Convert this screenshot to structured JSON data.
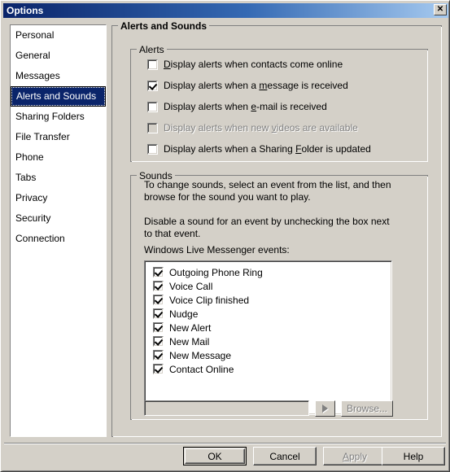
{
  "window": {
    "title": "Options",
    "close_icon": "close-icon",
    "close_label": "✕"
  },
  "sidebar": {
    "items": [
      {
        "label": "Personal",
        "selected": false
      },
      {
        "label": "General",
        "selected": false
      },
      {
        "label": "Messages",
        "selected": false
      },
      {
        "label": "Alerts and Sounds",
        "selected": true
      },
      {
        "label": "Sharing Folders",
        "selected": false
      },
      {
        "label": "File Transfer",
        "selected": false
      },
      {
        "label": "Phone",
        "selected": false
      },
      {
        "label": "Tabs",
        "selected": false
      },
      {
        "label": "Privacy",
        "selected": false
      },
      {
        "label": "Security",
        "selected": false
      },
      {
        "label": "Connection",
        "selected": false
      }
    ]
  },
  "main": {
    "page_title": "Alerts and Sounds",
    "alerts": {
      "group_label": "Alerts",
      "checkboxes": [
        {
          "pre": "",
          "accel": "D",
          "post": "isplay alerts when contacts come online",
          "checked": false,
          "disabled": false
        },
        {
          "pre": "Display alerts when a ",
          "accel": "m",
          "post": "essage is received",
          "checked": true,
          "disabled": false
        },
        {
          "pre": "Display alerts when ",
          "accel": "e",
          "post": "-mail is received",
          "checked": false,
          "disabled": false
        },
        {
          "pre": "Display alerts when new ",
          "accel": "v",
          "post": "ideos are available",
          "checked": false,
          "disabled": true
        },
        {
          "pre": "Display alerts when a Sharing ",
          "accel": "F",
          "post": "older is updated",
          "checked": false,
          "disabled": false
        }
      ]
    },
    "sounds": {
      "group_label": "Sounds",
      "description_1": "To change sounds, select an event from the list, and then browse for the sound you want to play.",
      "description_2": "Disable a sound for an event by unchecking the box next to that event.",
      "events_label": "Windows Live Messenger events:",
      "events": [
        {
          "label": "Outgoing Phone Ring",
          "checked": true
        },
        {
          "label": "Voice Call",
          "checked": true
        },
        {
          "label": "Voice Clip finished",
          "checked": true
        },
        {
          "label": "Nudge",
          "checked": true
        },
        {
          "label": "New Alert",
          "checked": true
        },
        {
          "label": "New Mail",
          "checked": true
        },
        {
          "label": "New Message",
          "checked": true
        },
        {
          "label": "Contact Online",
          "checked": true
        }
      ],
      "sound_path_value": "",
      "play_icon": "play-triangle-icon",
      "browse_label": "Browse..."
    }
  },
  "footer": {
    "buttons": [
      {
        "label": "OK",
        "default": true,
        "disabled": false
      },
      {
        "label": "Cancel",
        "default": false,
        "disabled": false
      },
      {
        "label": "Apply",
        "default": false,
        "disabled": true
      },
      {
        "label": "Help",
        "default": false,
        "disabled": false
      }
    ]
  },
  "colors": {
    "face": "#d4d0c8",
    "title_gradient_start": "#0a246a",
    "title_gradient_end": "#a6caf0",
    "highlight": "#0a246a",
    "window_bg": "#ffffff",
    "disabled_text": "#808080"
  }
}
